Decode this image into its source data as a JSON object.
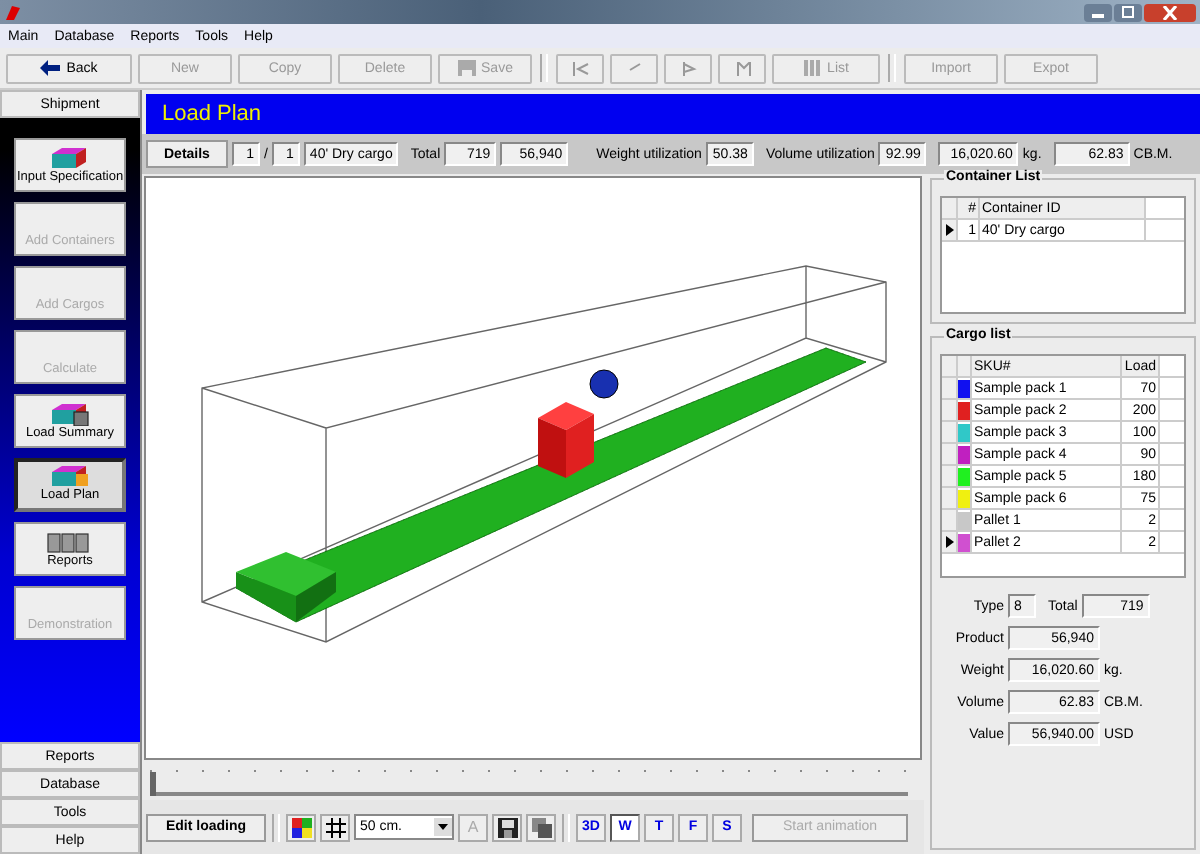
{
  "menu": [
    "Main",
    "Database",
    "Reports",
    "Tools",
    "Help"
  ],
  "toolbar": [
    {
      "kind": "back",
      "label": "Back",
      "disabled": false
    },
    {
      "kind": "text",
      "label": "New",
      "disabled": true
    },
    {
      "kind": "text",
      "label": "Copy",
      "disabled": true
    },
    {
      "kind": "text",
      "label": "Delete",
      "disabled": true
    },
    {
      "kind": "save",
      "label": "Save",
      "disabled": true
    },
    {
      "kind": "gap"
    },
    {
      "kind": "first",
      "disabled": true
    },
    {
      "kind": "prev",
      "disabled": true
    },
    {
      "kind": "next",
      "disabled": true
    },
    {
      "kind": "last",
      "disabled": true
    },
    {
      "kind": "list",
      "label": "List",
      "disabled": true
    },
    {
      "kind": "gap"
    },
    {
      "kind": "text",
      "label": "Import",
      "disabled": true
    },
    {
      "kind": "text",
      "label": "Expot",
      "disabled": true
    }
  ],
  "sidebar": {
    "header": "Shipment",
    "items": [
      {
        "label": "Input Specification",
        "kind": "container",
        "disabled": false,
        "selected": false
      },
      {
        "label": "Add Containers",
        "kind": "plain",
        "disabled": true,
        "selected": false
      },
      {
        "label": "Add Cargos",
        "kind": "plain",
        "disabled": true,
        "selected": false
      },
      {
        "label": "Calculate",
        "kind": "plain",
        "disabled": true,
        "selected": false
      },
      {
        "label": "Load Summary",
        "kind": "summary",
        "disabled": false,
        "selected": false
      },
      {
        "label": "Load Plan",
        "kind": "plan",
        "disabled": false,
        "selected": true
      },
      {
        "label": "Reports",
        "kind": "reports",
        "disabled": false,
        "selected": false
      },
      {
        "label": "Demonstration",
        "kind": "plain",
        "disabled": true,
        "selected": false
      }
    ],
    "sections": [
      "Reports",
      "Database",
      "Tools",
      "Help"
    ]
  },
  "page_title": "Load Plan",
  "info": {
    "details_button": "Details",
    "index": "1",
    "slash": "/",
    "count": "1",
    "container": "40' Dry cargo",
    "total_label": "Total",
    "total_qty": "719",
    "total_product": "56,940",
    "weight_label": "Weight utilization",
    "weight_util": "50.38",
    "volume_label": "Volume utilization",
    "volume_util": "92.99",
    "weight": "16,020.60",
    "weight_unit": "kg.",
    "volume": "62.83",
    "volume_unit": "CB.M."
  },
  "slider": {
    "level": 0
  },
  "bottom_toolbar": {
    "edit_button": "Edit loading",
    "scale": "50 cm.",
    "font_button": "A",
    "views": [
      {
        "label": "3D",
        "selected": false
      },
      {
        "label": "W",
        "selected": true
      },
      {
        "label": "T",
        "selected": false
      },
      {
        "label": "F",
        "selected": false
      },
      {
        "label": "S",
        "selected": false
      }
    ],
    "animation_button": "Start animation",
    "animation_disabled": true
  },
  "container_list": {
    "title": "Container List",
    "columns": [
      "#",
      "Container ID"
    ],
    "rows": [
      {
        "number": "1",
        "id": "40' Dry cargo",
        "current": true
      }
    ]
  },
  "cargo_list": {
    "title": "Cargo list",
    "columns": [
      "SKU#",
      "Load"
    ],
    "rows": [
      {
        "sku": "Sample pack 1",
        "load": "70",
        "color": "#1010f0",
        "current": false
      },
      {
        "sku": "Sample pack 2",
        "load": "200",
        "color": "#e02020",
        "current": false
      },
      {
        "sku": "Sample pack 3",
        "load": "100",
        "color": "#30c8c8",
        "current": false
      },
      {
        "sku": "Sample pack 4",
        "load": "90",
        "color": "#c020c0",
        "current": false
      },
      {
        "sku": "Sample pack 5",
        "load": "180",
        "color": "#20f020",
        "current": false
      },
      {
        "sku": "Sample pack 6",
        "load": "75",
        "color": "#f0f010",
        "current": false
      },
      {
        "sku": "Pallet 1",
        "load": "2",
        "color": "#c8c8c8",
        "current": false
      },
      {
        "sku": "Pallet 2",
        "load": "2",
        "color": "#d050d0",
        "current": true
      }
    ]
  },
  "summary": {
    "type_label": "Type",
    "type": "8",
    "total_label": "Total",
    "total": "719",
    "fields": [
      {
        "label": "Product",
        "value": "56,940"
      },
      {
        "label": "Weight",
        "value": "16,020.60",
        "unit": "kg."
      },
      {
        "label": "Volume",
        "value": "62.83",
        "unit": "CB.M."
      },
      {
        "label": "Value",
        "value": "56,940.00",
        "unit": "USD"
      }
    ]
  }
}
